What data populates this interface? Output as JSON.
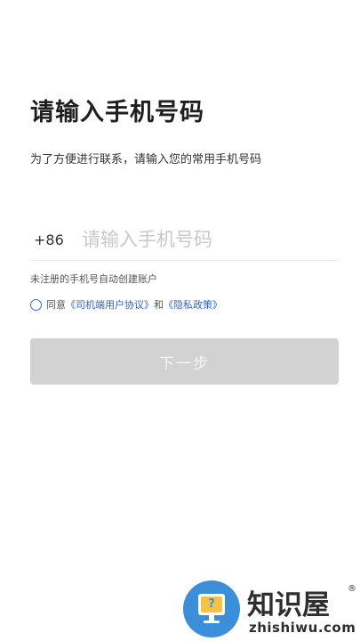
{
  "page": {
    "title": "请输入手机号码",
    "subtitle": "为了方便进行联系，请输入您的常用手机号码"
  },
  "phone": {
    "country_code": "+86",
    "placeholder": "请输入手机号码",
    "value": ""
  },
  "hint": "未注册的手机号自动创建账户",
  "agreement": {
    "checked": false,
    "prefix": "同意",
    "link1": "《司机端用户协议》",
    "connector": "和",
    "link2": "《隐私政策》"
  },
  "next_button": {
    "label": "下一步",
    "enabled": false
  },
  "watermark": {
    "icon_glyph": "?",
    "name": "知识屋",
    "registered": "®",
    "domain": "zhishiwu.com"
  },
  "colors": {
    "link": "#2f62c9",
    "radio_border": "#3a6fd8",
    "button_disabled_bg": "#d2d2d2",
    "watermark_badge": "#3b8fd9"
  },
  "icons": {
    "radio": "radio-unchecked-icon",
    "watermark": "monitor-question-icon"
  }
}
